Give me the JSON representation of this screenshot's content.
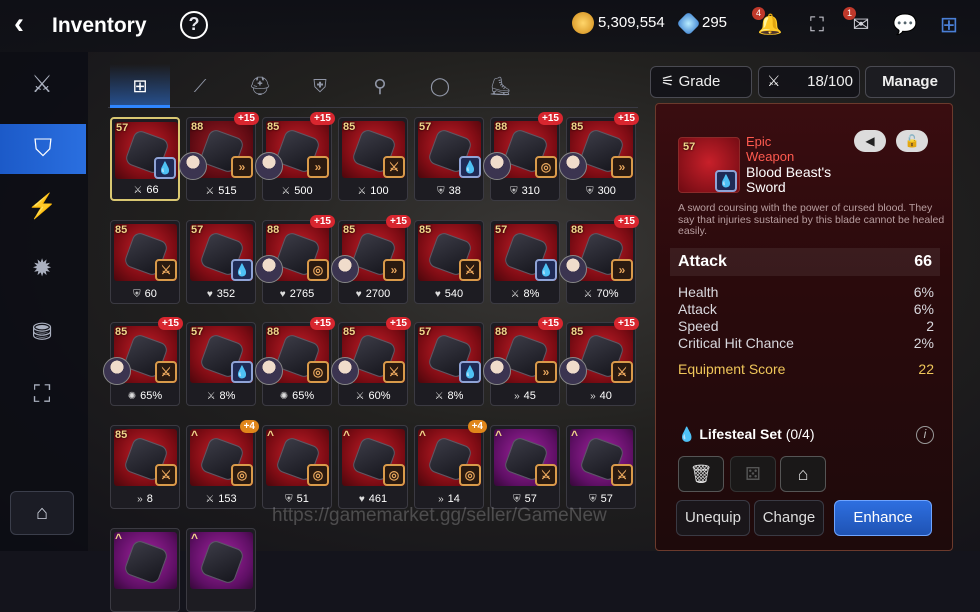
{
  "header": {
    "back_icon": "‹",
    "title": "Inventory",
    "help": "?",
    "gold": "5,309,554",
    "crystals": "295",
    "bell_badge": "4",
    "mail_badge": "1"
  },
  "tabs": [
    "⊞",
    "⟋",
    "⛑",
    "⛨",
    "⚲",
    "◯",
    "⛸"
  ],
  "grid": [
    {
      "lvl": "57",
      "plus": "",
      "stat_icon": "⚔",
      "stat": "66",
      "set": "💧",
      "setType": "blue",
      "hero": false,
      "art": "red",
      "sel": true
    },
    {
      "lvl": "88",
      "plus": "+15",
      "stat_icon": "⚔",
      "stat": "515",
      "set": "»",
      "setType": "orange",
      "hero": true,
      "art": "dark"
    },
    {
      "lvl": "85",
      "plus": "+15",
      "stat_icon": "⚔",
      "stat": "500",
      "set": "»",
      "setType": "orange",
      "hero": true,
      "art": "red"
    },
    {
      "lvl": "85",
      "plus": "",
      "stat_icon": "⚔",
      "stat": "100",
      "set": "⚔",
      "setType": "orange",
      "hero": false,
      "art": "red"
    },
    {
      "lvl": "57",
      "plus": "",
      "stat_icon": "⛨",
      "stat": "38",
      "set": "💧",
      "setType": "blue",
      "hero": false,
      "art": "red"
    },
    {
      "lvl": "88",
      "plus": "+15",
      "stat_icon": "⛨",
      "stat": "310",
      "set": "◎",
      "setType": "orange",
      "hero": true,
      "art": "red"
    },
    {
      "lvl": "85",
      "plus": "+15",
      "stat_icon": "⛨",
      "stat": "300",
      "set": "»",
      "setType": "orange",
      "hero": true,
      "art": "red"
    },
    {
      "lvl": "85",
      "plus": "",
      "stat_icon": "⛨",
      "stat": "60",
      "set": "⚔",
      "setType": "orange",
      "hero": false,
      "art": "red"
    },
    {
      "lvl": "57",
      "plus": "",
      "stat_icon": "♥",
      "stat": "352",
      "set": "💧",
      "setType": "blue",
      "hero": false,
      "art": "red"
    },
    {
      "lvl": "88",
      "plus": "+15",
      "stat_icon": "♥",
      "stat": "2765",
      "set": "◎",
      "setType": "orange",
      "hero": true,
      "art": "red"
    },
    {
      "lvl": "85",
      "plus": "+15",
      "stat_icon": "♥",
      "stat": "2700",
      "set": "»",
      "setType": "orange",
      "hero": true,
      "art": "red"
    },
    {
      "lvl": "85",
      "plus": "",
      "stat_icon": "♥",
      "stat": "540",
      "set": "⚔",
      "setType": "orange",
      "hero": false,
      "art": "red"
    },
    {
      "lvl": "57",
      "plus": "",
      "stat_icon": "⚔",
      "stat": "8%",
      "set": "💧",
      "setType": "blue",
      "hero": false,
      "art": "red"
    },
    {
      "lvl": "88",
      "plus": "+15",
      "stat_icon": "⚔",
      "stat": "70%",
      "set": "»",
      "setType": "orange",
      "hero": true,
      "art": "red"
    },
    {
      "lvl": "85",
      "plus": "+15",
      "stat_icon": "✺",
      "stat": "65%",
      "set": "⚔",
      "setType": "orange",
      "hero": true,
      "art": "red"
    },
    {
      "lvl": "57",
      "plus": "",
      "stat_icon": "⚔",
      "stat": "8%",
      "set": "💧",
      "setType": "blue",
      "hero": false,
      "art": "red"
    },
    {
      "lvl": "88",
      "plus": "+15",
      "stat_icon": "✺",
      "stat": "65%",
      "set": "◎",
      "setType": "orange",
      "hero": true,
      "art": "red"
    },
    {
      "lvl": "85",
      "plus": "+15",
      "stat_icon": "⚔",
      "stat": "60%",
      "set": "⚔",
      "setType": "orange",
      "hero": true,
      "art": "red"
    },
    {
      "lvl": "57",
      "plus": "",
      "stat_icon": "⚔",
      "stat": "8%",
      "set": "💧",
      "setType": "blue",
      "hero": false,
      "art": "red"
    },
    {
      "lvl": "88",
      "plus": "+15",
      "stat_icon": "»",
      "stat": "45",
      "set": "»",
      "setType": "orange",
      "hero": true,
      "art": "red"
    },
    {
      "lvl": "85",
      "plus": "+15",
      "stat_icon": "»",
      "stat": "40",
      "set": "⚔",
      "setType": "orange",
      "hero": true,
      "art": "red"
    },
    {
      "lvl": "85",
      "plus": "",
      "stat_icon": "»",
      "stat": "8",
      "set": "⚔",
      "setType": "orange",
      "hero": false,
      "art": "red"
    },
    {
      "lvl": "^",
      "plus": "+4",
      "stat_icon": "⚔",
      "stat": "153",
      "set": "◎",
      "setType": "orange",
      "hero": false,
      "art": "red",
      "orange": true
    },
    {
      "lvl": "^",
      "plus": "",
      "stat_icon": "⛨",
      "stat": "51",
      "set": "◎",
      "setType": "orange",
      "hero": false,
      "art": "red"
    },
    {
      "lvl": "^",
      "plus": "",
      "stat_icon": "♥",
      "stat": "461",
      "set": "◎",
      "setType": "orange",
      "hero": false,
      "art": "red"
    },
    {
      "lvl": "^",
      "plus": "+4",
      "stat_icon": "»",
      "stat": "14",
      "set": "◎",
      "setType": "orange",
      "hero": false,
      "art": "red",
      "orange": true
    },
    {
      "lvl": "^",
      "plus": "",
      "stat_icon": "⛨",
      "stat": "57",
      "set": "⚔",
      "setType": "orange",
      "hero": false,
      "art": "purple"
    },
    {
      "lvl": "^",
      "plus": "",
      "stat_icon": "⛨",
      "stat": "57",
      "set": "⚔",
      "setType": "orange",
      "hero": false,
      "art": "purple"
    },
    {
      "lvl": "^",
      "plus": "",
      "stat_icon": "",
      "stat": "",
      "set": "",
      "setType": "orange",
      "hero": false,
      "art": "purple"
    },
    {
      "lvl": "^",
      "plus": "",
      "stat_icon": "",
      "stat": "",
      "set": "",
      "setType": "orange",
      "hero": false,
      "art": "purple"
    }
  ],
  "toolbar": {
    "grade_label": "Grade",
    "capacity": "18/100",
    "manage_label": "Manage"
  },
  "detail": {
    "grade": "Epic",
    "type": "Weapon",
    "name_line1": "Blood Beast's",
    "name_line2": "Sword",
    "level": "57",
    "description": "A sword coursing with the power of cursed blood. They say that injuries sustained by this blade cannot be healed easily.",
    "main_stat": {
      "name": "Attack",
      "value": "66"
    },
    "substats": [
      {
        "name": "Health",
        "value": "6%"
      },
      {
        "name": "Attack",
        "value": "6%"
      },
      {
        "name": "Speed",
        "value": "2"
      },
      {
        "name": "Critical Hit Chance",
        "value": "2%"
      }
    ],
    "score": {
      "name": "Equipment Score",
      "value": "22"
    },
    "set_label": "Lifesteal Set",
    "set_count": "(0/4)"
  },
  "actions": {
    "unequip": "Unequip",
    "change": "Change",
    "enhance": "Enhance"
  },
  "watermark": "https://gamemarket.gg/seller/GameNew"
}
